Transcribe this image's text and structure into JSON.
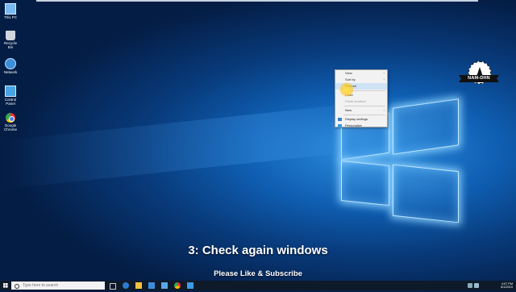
{
  "desktop": {
    "icons": [
      {
        "label": "This PC",
        "icon": "computer-icon"
      },
      {
        "label": "Recycle Bin",
        "icon": "recycle-bin-icon"
      },
      {
        "label": "Network",
        "icon": "network-icon"
      },
      {
        "label": "Control Panel",
        "icon": "control-panel-icon"
      },
      {
        "label": "Google Chrome",
        "icon": "chrome-icon"
      }
    ]
  },
  "context_menu": {
    "items": [
      {
        "label": "View"
      },
      {
        "label": "Sort by"
      },
      {
        "label": "Refresh"
      },
      {
        "label": "Undo"
      },
      {
        "label": "Paste shortcut"
      },
      {
        "label": "New"
      },
      {
        "label": "Display settings"
      },
      {
        "label": "Personalize"
      }
    ]
  },
  "badge": {
    "label": "NAM-DHN"
  },
  "captions": {
    "title": "3: Check again windows",
    "subtitle": "Please Like & Subscribe"
  },
  "taskbar": {
    "search_placeholder": "Type here to search",
    "clock_time": "4:07 PM",
    "clock_date": "8/1/2019",
    "apps": [
      "task-view-icon",
      "edge-icon",
      "file-explorer-icon",
      "store-icon",
      "mail-icon",
      "chrome-icon",
      "photos-icon"
    ]
  },
  "colors": {
    "wallpaper": "#0f5fb3",
    "taskbar": "#0e1a2a",
    "menu_highlight": "#cfe3f7"
  }
}
